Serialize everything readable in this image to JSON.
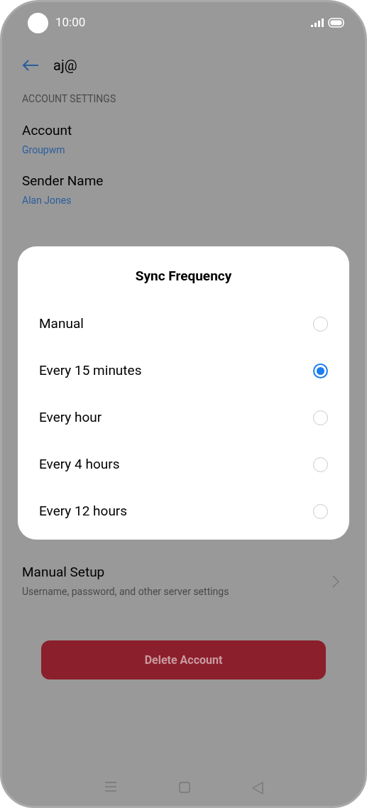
{
  "status_bar": {
    "time": "10:00"
  },
  "header": {
    "title": "aj@"
  },
  "section": {
    "title": "ACCOUNT SETTINGS"
  },
  "settings": [
    {
      "label": "Account",
      "value": "Groupwm"
    },
    {
      "label": "Sender Name",
      "value": "Alan Jones"
    }
  ],
  "manual_setup": {
    "label": "Manual Setup",
    "description": "Username, password, and other server settings"
  },
  "delete_button": {
    "label": "Delete Account"
  },
  "dialog": {
    "title": "Sync Frequency",
    "options": [
      {
        "label": "Manual",
        "selected": false
      },
      {
        "label": "Every 15 minutes",
        "selected": true
      },
      {
        "label": "Every hour",
        "selected": false
      },
      {
        "label": "Every 4 hours",
        "selected": false
      },
      {
        "label": "Every 12 hours",
        "selected": false
      }
    ]
  }
}
